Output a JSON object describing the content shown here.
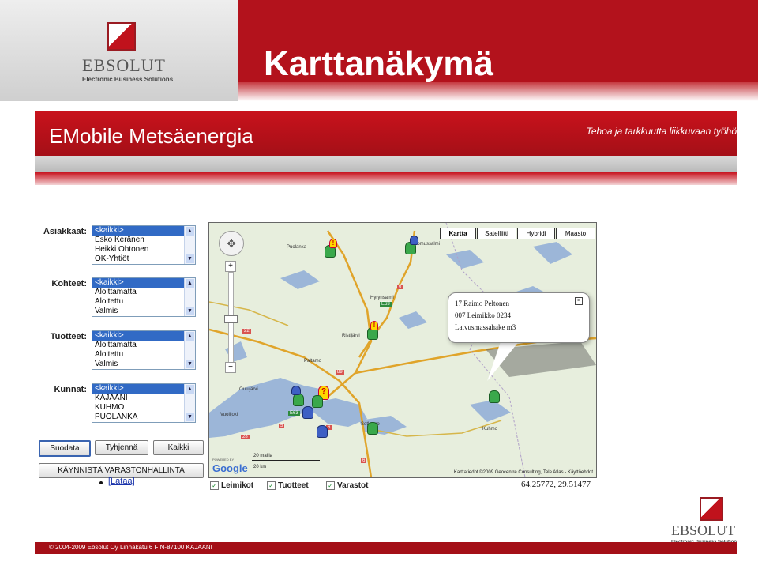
{
  "slide": {
    "title": "Karttanäkymä",
    "logo": {
      "name": "EBSOLUT",
      "tagline": "Electronic Business Solutions"
    }
  },
  "app": {
    "title": "EMobile Metsäenergia",
    "tagline": "Tehoa ja tarkkuutta liikkuvaan työhö"
  },
  "filters": [
    {
      "label": "Asiakkaat:",
      "options": [
        "<kaikki>",
        "Esko Keränen",
        "Heikki Ohtonen",
        "OK-Yhtiöt"
      ],
      "selected": 0
    },
    {
      "label": "Kohteet:",
      "options": [
        "<kaikki>",
        "Aloittamatta",
        "Aloitettu",
        "Valmis"
      ],
      "selected": 0
    },
    {
      "label": "Tuotteet:",
      "options": [
        "<kaikki>",
        "Aloittamatta",
        "Aloitettu",
        "Valmis"
      ],
      "selected": 0
    },
    {
      "label": "Kunnat:",
      "options": [
        "<kaikki>",
        "KAJAANI",
        "KUHMO",
        "PUOLANKA"
      ],
      "selected": 0
    }
  ],
  "buttons": {
    "filter": "Suodata",
    "clear": "Tyhjennä",
    "all": "Kaikki",
    "warehouse": "KÄYNNISTÄ VARASTONHALLINTA",
    "load": "[Lataa]"
  },
  "map": {
    "types": [
      "Kartta",
      "Satelliitti",
      "Hybridi",
      "Maasto"
    ],
    "active_type": "Kartta",
    "towns": [
      "Puolanka",
      "Suomussalmi",
      "Hyrynsalmi",
      "Ristijärvi",
      "Paltamo",
      "Oulujärvi",
      "Vuolijoki",
      "Sotkamo",
      "Kuhmo"
    ],
    "routes": [
      "6",
      "E63",
      "22",
      "89",
      "5",
      "E63",
      "6",
      "28",
      "6"
    ],
    "popup": {
      "line1": "17 Raimo Peltonen",
      "line2": "007 Leimikko 0234",
      "line3": "Latvusmassahake m3"
    },
    "scale": {
      "miles": "20 mailia",
      "km": "20 km"
    },
    "attribution": "Karttatiedot ©2009 Geocentre Consulting, Tele Atlas - Käyttöehdot",
    "brand": "Google",
    "powered": "POWERED BY"
  },
  "layers": [
    {
      "label": "Leimikot",
      "checked": true
    },
    {
      "label": "Tuotteet",
      "checked": true
    },
    {
      "label": "Varastot",
      "checked": true
    }
  ],
  "coordinates": "64.25772, 29.51477",
  "footer": "© 2004-2009 Ebsolut Oy  Linnakatu 6 FIN-87100 KAJAANI",
  "colors": {
    "brand_red": "#b3121c",
    "selection_blue": "#316ac5"
  }
}
